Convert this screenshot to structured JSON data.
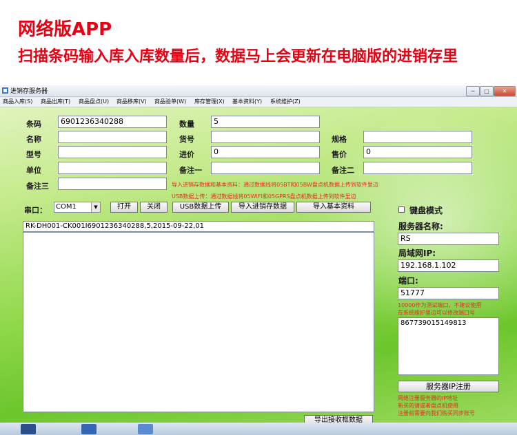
{
  "banner": {
    "line1": "网络版APP",
    "line2": "扫描条码输入库入库数量后，数据马上会更新在电脑版的进销存里"
  },
  "window": {
    "title": "进销存服务器",
    "controls": [
      "─",
      "□",
      "✕"
    ]
  },
  "menu": [
    "商品入库(S)",
    "商品出库(T)",
    "商品盘点(U)",
    "商品移库(V)",
    "商品验单(W)",
    "库存管理(X)",
    "基本资料(Y)",
    "系统维护(Z)"
  ],
  "form": {
    "barcode": {
      "label": "条码",
      "value": "6901236340288"
    },
    "quantity": {
      "label": "数量",
      "value": "5"
    },
    "name": {
      "label": "名称",
      "value": ""
    },
    "item_no": {
      "label": "货号",
      "value": ""
    },
    "spec": {
      "label": "规格",
      "value": ""
    },
    "model": {
      "label": "型号",
      "value": ""
    },
    "purchase_price": {
      "label": "进价",
      "value": "0"
    },
    "sale_price": {
      "label": "售价",
      "value": "0"
    },
    "unit": {
      "label": "单位",
      "value": ""
    },
    "remark1": {
      "label": "备注一",
      "value": ""
    },
    "remark2": {
      "label": "备注二",
      "value": ""
    },
    "remark3": {
      "label": "备注三",
      "value": ""
    }
  },
  "notes": {
    "import_note": "导入进销存数据和基本资料：通过数据线将05BT和05BW盘点机数据上传到软件里边",
    "usb_note": "USB数据上传：通过数据线将05WIFI和05GPRS盘点机数据上传到软件里边"
  },
  "toolbar": {
    "port_label": "串口：",
    "port_value": "COM1",
    "open": "打开",
    "close": "关闭",
    "usb_upload": "USB数据上传",
    "import_inventory": "导入进销存数据",
    "import_basic": "导入基本资料"
  },
  "log": {
    "line1": "RK-DH001-CK001I6901236340288,5,2015-09-22,01"
  },
  "export_button": "导出接收框数据",
  "server": {
    "keyboard_mode": "键盘模式",
    "server_name_label": "服务器名称:",
    "server_name": "RS",
    "lan_ip_label": "局域网IP:",
    "lan_ip": "192.168.1.102",
    "port_label": "端口:",
    "port": "51777",
    "port_note1": "10000作为测试端口，不建议使用",
    "port_note2": "在系统维护里边可以修改端口号",
    "device_id": "867739015149813",
    "register_button": "服务器IP注册",
    "reg_note1": "网络注册服务器的IP地址",
    "reg_note2": "新买的请或者盘点机使用",
    "reg_note3": "注册前需要向我们购买同步账号"
  },
  "colors": {
    "banner_red": "#e60012",
    "note_red": "#e0301e",
    "window_green": "#8fd84a"
  }
}
